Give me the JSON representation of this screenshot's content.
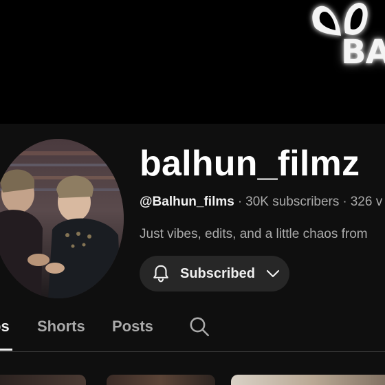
{
  "banner": {
    "text": "BA",
    "background": "#000000"
  },
  "channel": {
    "name": "balhun_filmz",
    "handle": "@Balhun_films",
    "subscribers": "30K subscribers",
    "videos": "326 v",
    "description": "Just vibes, edits, and a little chaos from"
  },
  "subscribe_button": {
    "label": "Subscribed",
    "icon": "bell-icon",
    "dropdown_icon": "chevron-down-icon"
  },
  "tabs": [
    {
      "label": "os",
      "active": true
    },
    {
      "label": "Shorts",
      "active": false
    },
    {
      "label": "Posts",
      "active": false
    }
  ],
  "search_tab_icon": "search-icon",
  "colors": {
    "background": "#0f0f0f",
    "button_bg": "#272727",
    "secondary_text": "#aaaaaa",
    "primary_text": "#f1f1f1"
  }
}
